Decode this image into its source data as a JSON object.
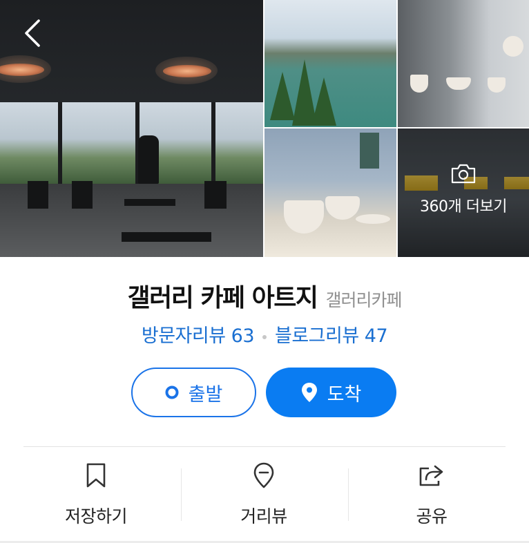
{
  "header": {
    "back_icon": "chevron-left-icon"
  },
  "gallery": {
    "more_photos_icon": "camera-icon",
    "more_photos_label": "360개 더보기"
  },
  "place": {
    "name": "갤러리 카페 아트지",
    "category": "갤러리카페",
    "visitor_reviews_label": "방문자리뷰 63",
    "blog_reviews_label": "블로그리뷰 47"
  },
  "route": {
    "start_label": "출발",
    "arrive_label": "도착"
  },
  "actions": [
    {
      "label": "저장하기",
      "icon": "bookmark-icon"
    },
    {
      "label": "거리뷰",
      "icon": "street-view-pin-icon"
    },
    {
      "label": "공유",
      "icon": "share-icon"
    }
  ],
  "colors": {
    "accent": "#1a73e8",
    "accent_fill": "#0a7cf2",
    "review_link": "#1a6fd1",
    "category_gray": "#8f8f8f"
  }
}
